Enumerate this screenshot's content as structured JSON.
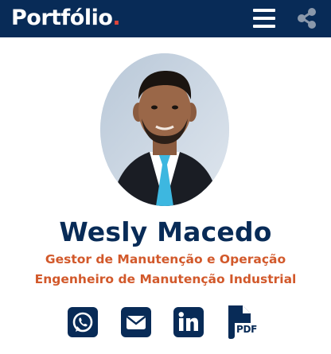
{
  "header": {
    "brand": "Portfólio",
    "brand_dot": ".",
    "menu_icon": "hamburger-menu-icon",
    "share_icon": "share-icon"
  },
  "profile": {
    "name": "Wesly Macedo",
    "roles": [
      "Gestor de Manutenção e Operação",
      "Engenheiro de Manutenção Industrial"
    ]
  },
  "social": [
    {
      "icon": "whatsapp-icon"
    },
    {
      "icon": "email-icon"
    },
    {
      "icon": "linkedin-icon"
    },
    {
      "icon": "pdf-file-icon",
      "label": "PDF"
    }
  ],
  "colors": {
    "header_bg": "#082b57",
    "accent": "#d2592b",
    "brand_dot": "#e0463b",
    "name": "#082b57"
  }
}
